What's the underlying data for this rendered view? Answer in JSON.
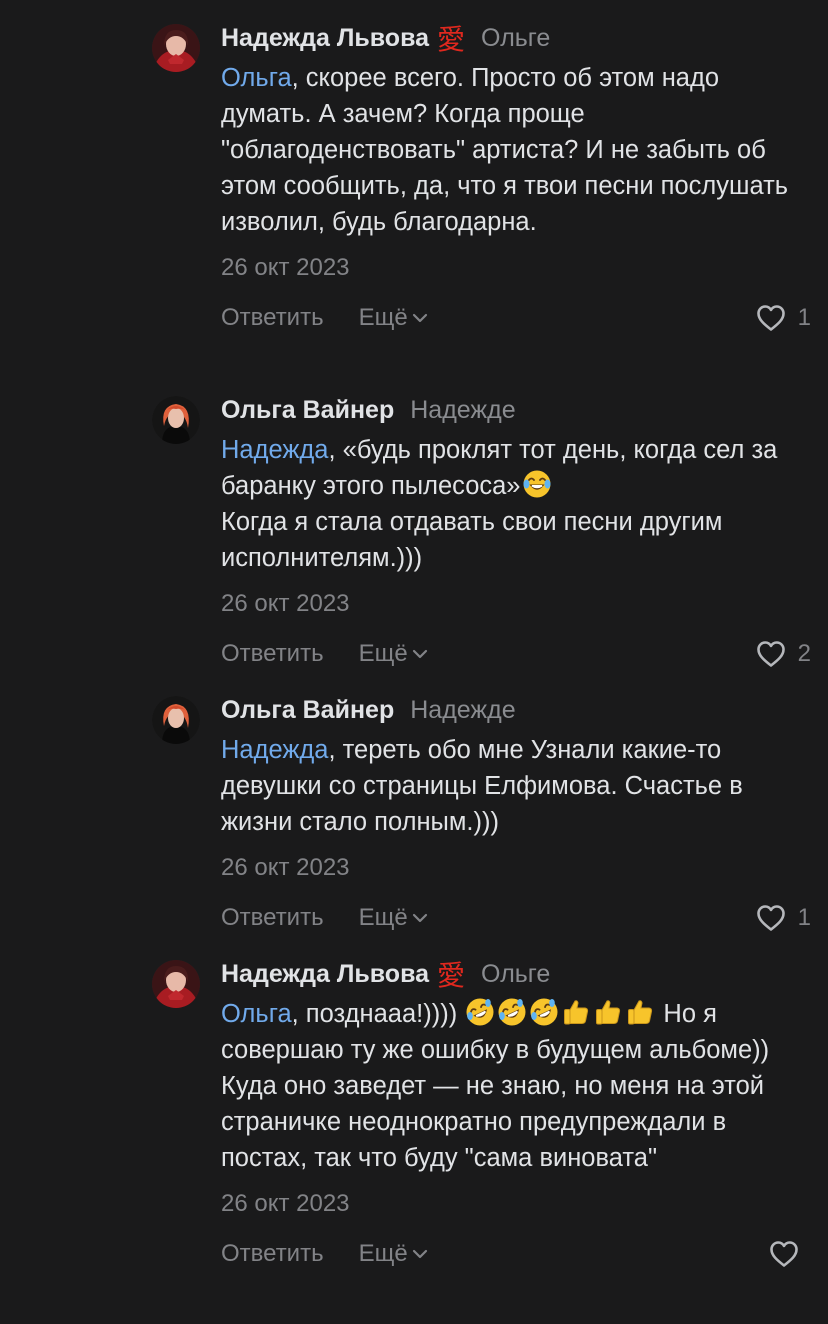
{
  "comments": [
    {
      "author": "Надежда Львова",
      "author_badge": "愛",
      "reply_to": "Ольге",
      "mention": "Ольга",
      "text": ", скорее всего. Просто об этом надо думать. А зачем? Когда проще \"облагоденствовать\" артиста? И не забыть об этом сообщить, да, что я твои песни послушать изволил, будь благодарна.",
      "date": "26 окт 2023",
      "reply_label": "Ответить",
      "more_label": "Ещё",
      "likes": "1"
    },
    {
      "author": "Ольга Вайнер",
      "reply_to": "Надежде",
      "mention": "Надежда",
      "text": ", «будь проклят тот день, когда сел за баранку этого пылесоса»",
      "text2": "Когда я стала отдавать свои песни другим исполнителям.)))",
      "emoji_after_text": "face-with-tears-of-joy",
      "date": "26 окт 2023",
      "reply_label": "Ответить",
      "more_label": "Ещё",
      "likes": "2"
    },
    {
      "author": "Ольга Вайнер",
      "reply_to": "Надежде",
      "mention": "Надежда",
      "text": ", тереть обо мне Узнали какие-то девушки со страницы Елфимова. Счастье в жизни стало полным.)))",
      "date": "26 окт 2023",
      "reply_label": "Ответить",
      "more_label": "Ещё",
      "likes": "1"
    },
    {
      "author": "Надежда Львова",
      "author_badge": "愛",
      "reply_to": "Ольге",
      "mention": "Ольга",
      "text_pre": ", позднааа!))))",
      "emojis": [
        "rolling-on-floor-laughing",
        "rolling-on-floor-laughing",
        "rolling-on-floor-laughing",
        "thumbs-up",
        "thumbs-up",
        "thumbs-up"
      ],
      "text_post": "Но я совершаю ту же ошибку в будущем альбоме)) Куда оно заведет — не знаю, но меня на этой страничке неоднократно предупреждали в постах, так что буду \"сама виновата\"",
      "date": "26 окт 2023",
      "reply_label": "Ответить",
      "more_label": "Ещё",
      "likes": ""
    }
  ],
  "colors": {
    "background": "#1a1a1b",
    "text": "#e1e3e6",
    "secondary": "#828387",
    "mention": "#71aaeb",
    "badge": "#e0281e"
  }
}
